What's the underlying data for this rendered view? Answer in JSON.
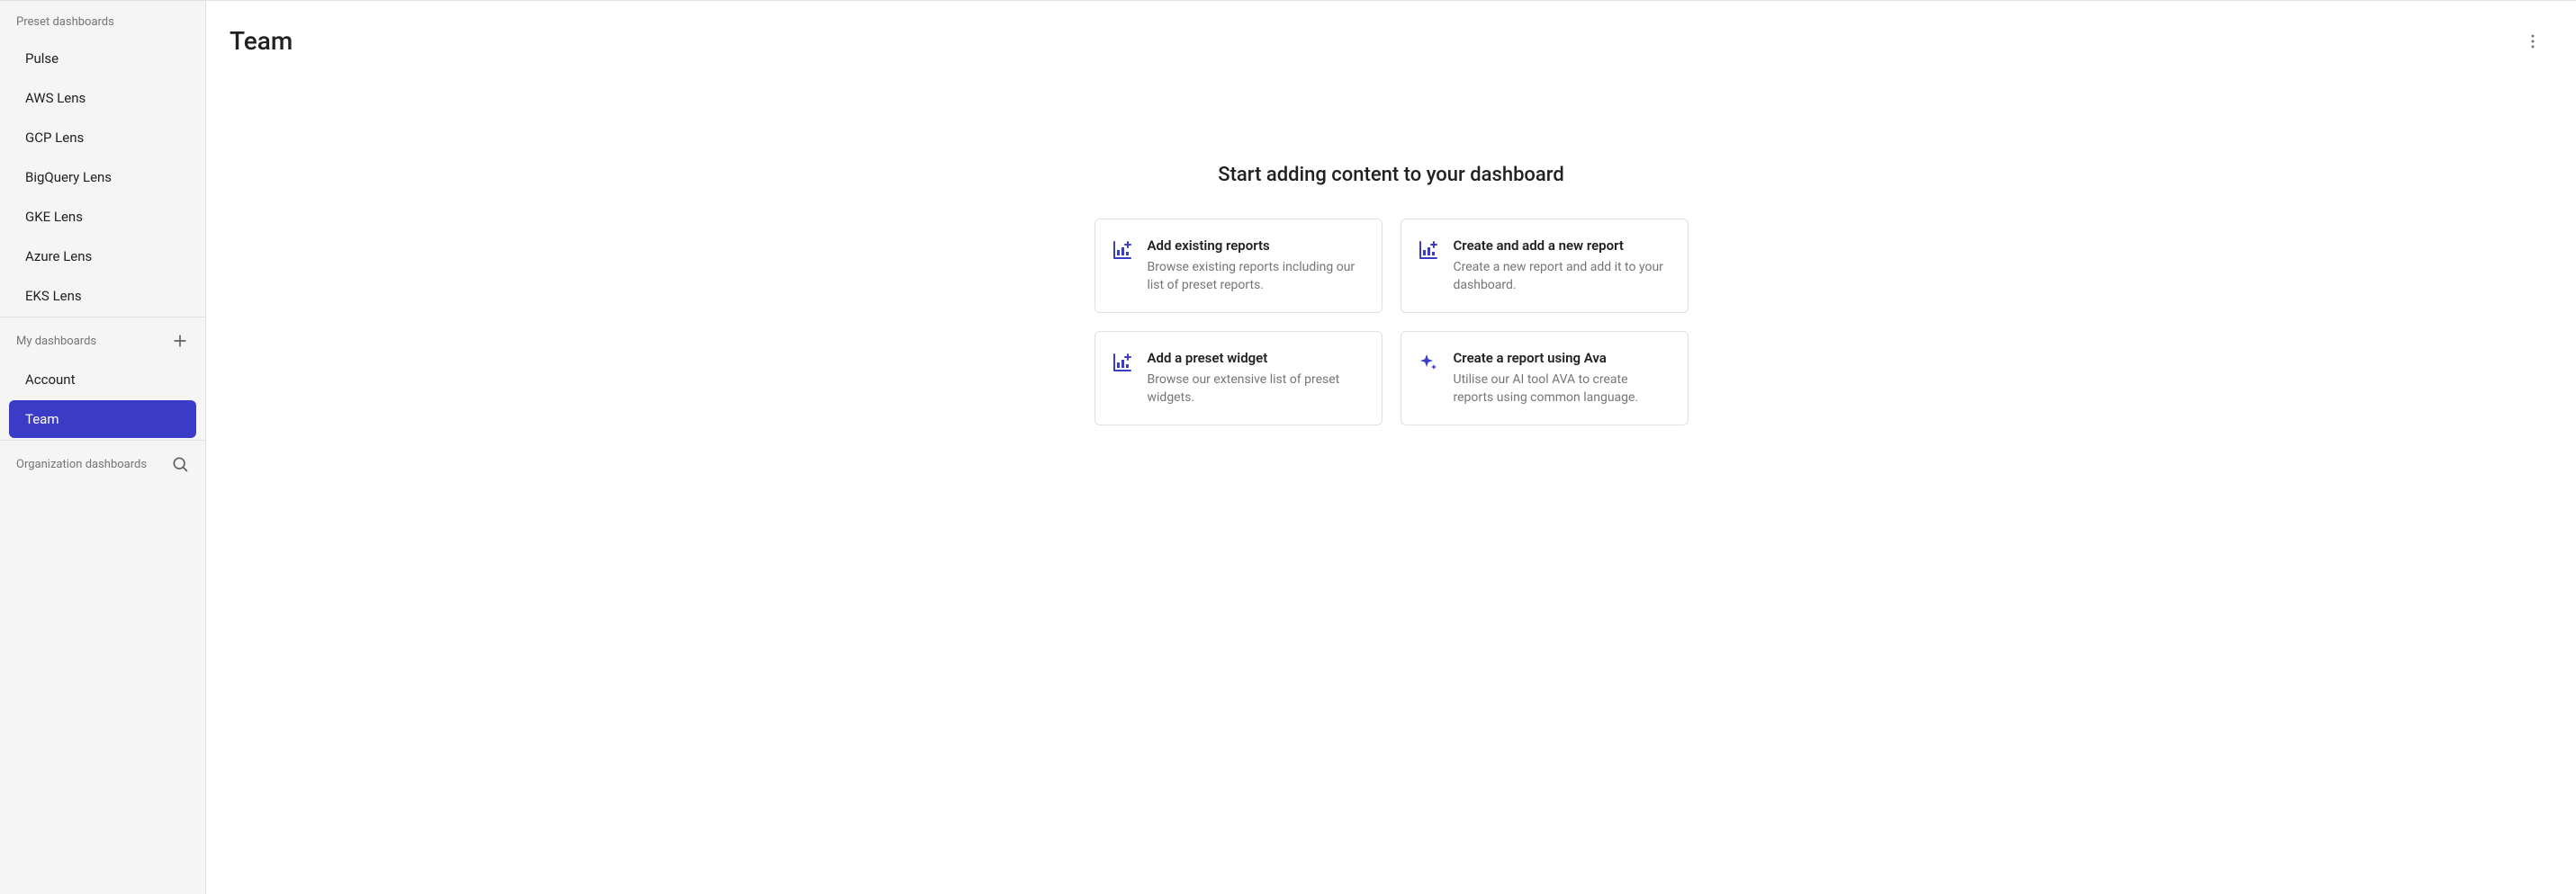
{
  "sidebar": {
    "sections": [
      {
        "label": "Preset dashboards",
        "items": [
          {
            "label": "Pulse"
          },
          {
            "label": "AWS Lens"
          },
          {
            "label": "GCP Lens"
          },
          {
            "label": "BigQuery Lens"
          },
          {
            "label": "GKE Lens"
          },
          {
            "label": "Azure Lens"
          },
          {
            "label": "EKS Lens"
          }
        ]
      },
      {
        "label": "My dashboards",
        "action": "plus",
        "items": [
          {
            "label": "Account"
          },
          {
            "label": "Team",
            "active": true
          }
        ]
      },
      {
        "label": "Organization dashboards",
        "action": "search",
        "items": []
      }
    ]
  },
  "page": {
    "title": "Team"
  },
  "empty_state": {
    "title": "Start adding content to your dashboard",
    "cards": [
      {
        "icon": "chart-plus",
        "title": "Add existing reports",
        "desc": "Browse existing reports including our list of preset reports."
      },
      {
        "icon": "chart-plus",
        "title": "Create and add a new report",
        "desc": "Create a new report and add it to your dashboard."
      },
      {
        "icon": "chart-plus",
        "title": "Add a preset widget",
        "desc": "Browse our extensive list of preset widgets."
      },
      {
        "icon": "sparkle",
        "title": "Create a report using Ava",
        "desc": "Utilise our AI tool AVA to create reports using common language."
      }
    ]
  }
}
